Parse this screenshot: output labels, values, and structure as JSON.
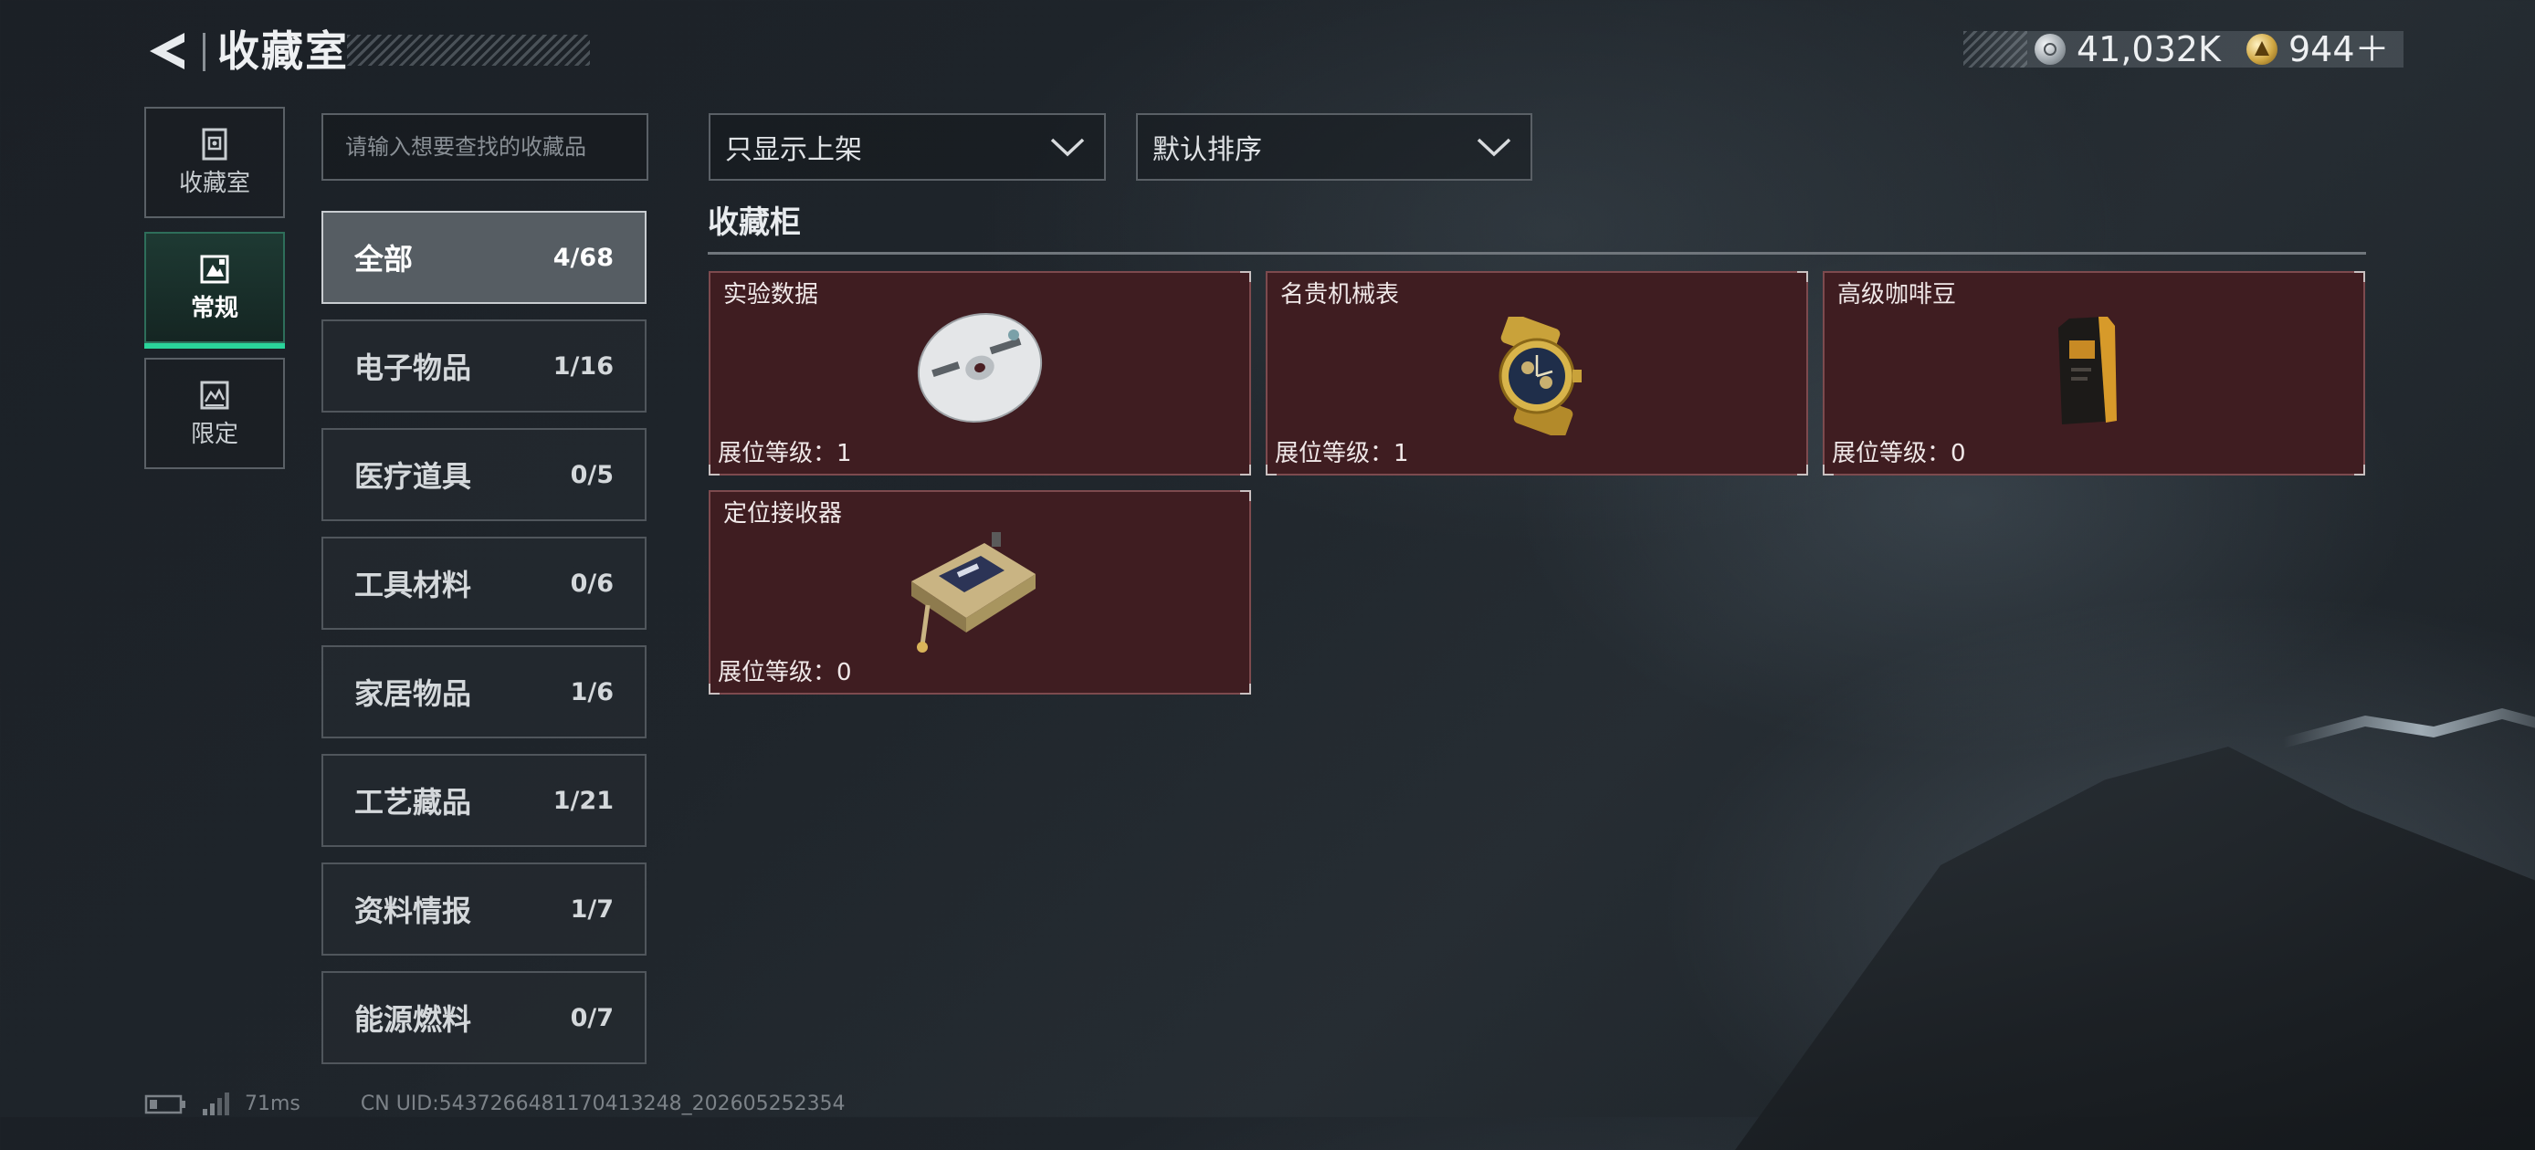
{
  "header": {
    "title": "收藏室",
    "currencies": [
      {
        "icon": "silver-coin-icon",
        "value": "41,032K"
      },
      {
        "icon": "gold-coin-icon",
        "value": "944＋"
      }
    ]
  },
  "nav": {
    "tabs": [
      {
        "label": "收藏室",
        "icon": "collection-room-icon",
        "active": false
      },
      {
        "label": "常规",
        "icon": "regular-icon",
        "active": true
      },
      {
        "label": "限定",
        "icon": "limited-icon",
        "active": false
      }
    ]
  },
  "search": {
    "placeholder": "请输入想要查找的收藏品"
  },
  "categories": [
    {
      "label": "全部",
      "count": "4/68",
      "active": true
    },
    {
      "label": "电子物品",
      "count": "1/16"
    },
    {
      "label": "医疗道具",
      "count": "0/5"
    },
    {
      "label": "工具材料",
      "count": "0/6"
    },
    {
      "label": "家居物品",
      "count": "1/6"
    },
    {
      "label": "工艺藏品",
      "count": "1/21"
    },
    {
      "label": "资料情报",
      "count": "1/7"
    },
    {
      "label": "能源燃料",
      "count": "0/7"
    }
  ],
  "filters": {
    "show_filter": "只显示上架",
    "sort": "默认排序"
  },
  "section": {
    "title": "收藏柜"
  },
  "items": [
    {
      "name": "实验数据",
      "level": "展位等级：1",
      "icon": "disc-icon"
    },
    {
      "name": "名贵机械表",
      "level": "展位等级：1",
      "icon": "wristwatch-icon"
    },
    {
      "name": "高级咖啡豆",
      "level": "展位等级：0",
      "icon": "coffee-bag-icon"
    },
    {
      "name": "定位接收器",
      "level": "展位等级：0",
      "icon": "gps-receiver-icon"
    }
  ],
  "footer": {
    "ping": "71ms",
    "uid": "CN UID:5437266481170413248_202605252354"
  },
  "colors": {
    "accent": "#2ad49a",
    "card_bg": "#3f1d21",
    "card_border": "#7d4a4e"
  }
}
